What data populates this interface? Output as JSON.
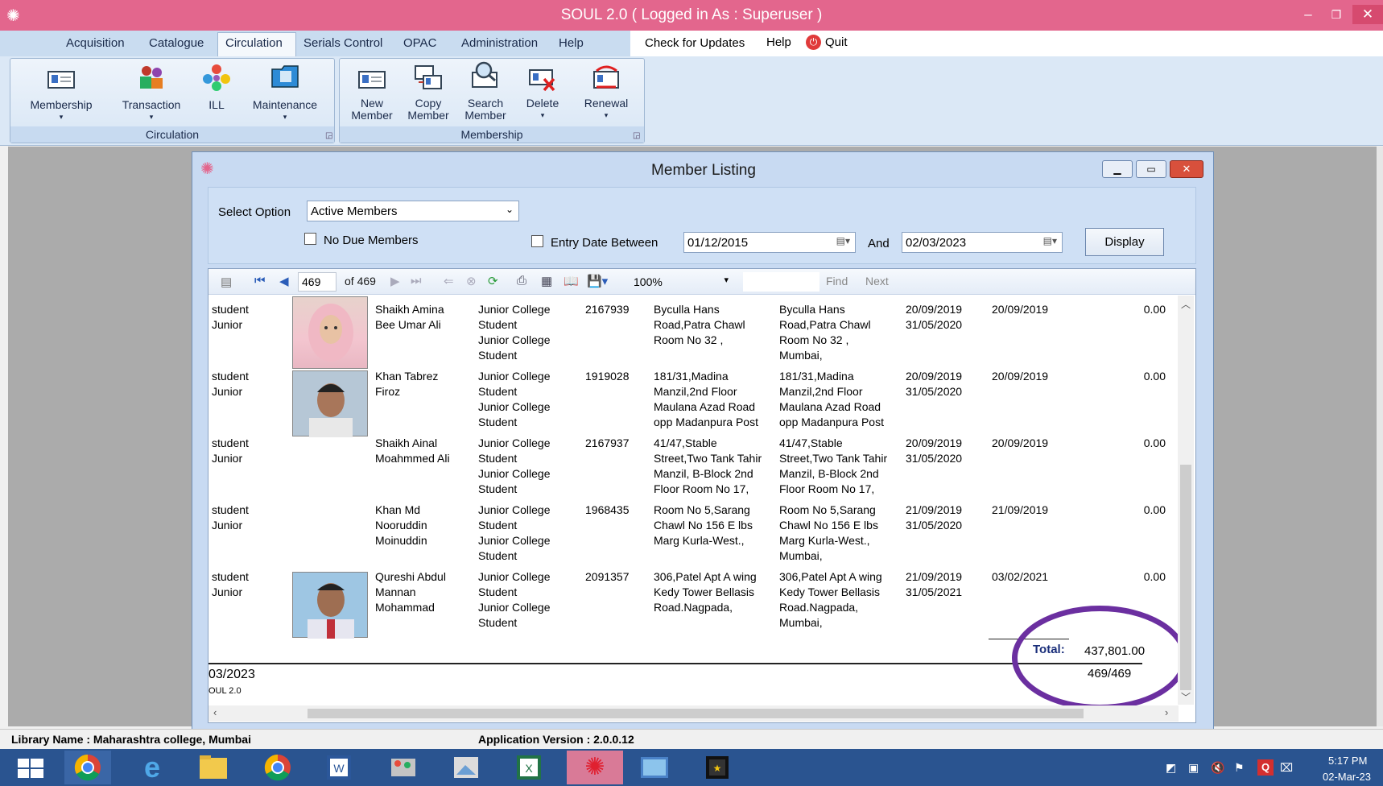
{
  "app": {
    "title": "SOUL 2.0  ( Logged in As : Superuser )"
  },
  "menu": {
    "items": [
      "Acquisition",
      "Catalogue",
      "Circulation",
      "Serials Control",
      "OPAC",
      "Administration",
      "Help"
    ],
    "right": [
      "Check for Updates",
      "Help",
      "Quit"
    ]
  },
  "ribbon": {
    "circulation_group": {
      "label": "Circulation",
      "buttons": [
        "Membership",
        "Transaction",
        "ILL",
        "Maintenance"
      ]
    },
    "membership_group": {
      "label": "Membership",
      "buttons": [
        [
          "New",
          "Member"
        ],
        [
          "Copy",
          "Member"
        ],
        [
          "Search",
          "Member"
        ],
        [
          "Delete",
          ""
        ],
        [
          "Renewal",
          ""
        ]
      ]
    }
  },
  "window": {
    "title": "Member Listing",
    "filter": {
      "select_option_label": "Select Option",
      "select_option_value": "Active Members",
      "no_due_label": "No Due Members",
      "entry_date_label": "Entry Date Between",
      "date_from": "01/12/2015",
      "and_label": "And",
      "date_to": "02/03/2023",
      "display_button": "Display"
    }
  },
  "toolbar": {
    "page": "469",
    "of_label": "of 469",
    "zoom": "100%",
    "find": "Find",
    "next": "Next"
  },
  "rows": [
    {
      "cat": [
        "student",
        "Junior"
      ],
      "name": [
        "Shaikh Amina",
        "Bee Umar Ali"
      ],
      "course": [
        "Junior College",
        "Student",
        "Junior College",
        "Student"
      ],
      "id": "2167939",
      "addr1": [
        "Byculla Hans",
        "Road,Patra Chawl",
        "Room No 32 ,"
      ],
      "addr2": [
        "Byculla Hans",
        "Road,Patra Chawl",
        "Room No 32 ,",
        "Mumbai,"
      ],
      "dates": [
        "20/09/2019",
        "31/05/2020"
      ],
      "date2": "20/09/2019",
      "amount": "0.00"
    },
    {
      "cat": [
        "student",
        "Junior"
      ],
      "name": [
        "Khan Tabrez",
        "Firoz"
      ],
      "course": [
        "Junior College",
        "Student",
        "Junior College",
        "Student"
      ],
      "id": "1919028",
      "addr1": [
        "181/31,Madina",
        "Manzil,2nd Floor",
        "Maulana Azad Road",
        "opp Madanpura Post"
      ],
      "addr2": [
        "181/31,Madina",
        "Manzil,2nd Floor",
        "Maulana Azad Road",
        "opp Madanpura Post"
      ],
      "dates": [
        "20/09/2019",
        "31/05/2020"
      ],
      "date2": "20/09/2019",
      "amount": "0.00"
    },
    {
      "cat": [
        "student",
        "Junior"
      ],
      "name": [
        "Shaikh Ainal",
        "Moahmmed Ali"
      ],
      "course": [
        "Junior College",
        "Student",
        "Junior College",
        "Student"
      ],
      "id": "2167937",
      "addr1": [
        "41/47,Stable",
        "Street,Two Tank Tahir",
        "Manzil, B-Block 2nd",
        "Floor Room No 17,"
      ],
      "addr2": [
        "41/47,Stable",
        "Street,Two Tank Tahir",
        "Manzil, B-Block 2nd",
        "Floor Room No 17,"
      ],
      "dates": [
        "20/09/2019",
        "31/05/2020"
      ],
      "date2": "20/09/2019",
      "amount": "0.00"
    },
    {
      "cat": [
        "student",
        "Junior"
      ],
      "name": [
        "Khan Md",
        "Nooruddin",
        "Moinuddin"
      ],
      "course": [
        "Junior College",
        "Student",
        "Junior College",
        "Student"
      ],
      "id": "1968435",
      "addr1": [
        "Room No 5,Sarang",
        "Chawl No 156 E lbs",
        "Marg Kurla-West.,"
      ],
      "addr2": [
        "Room No 5,Sarang",
        "Chawl No 156 E lbs",
        "Marg Kurla-West.,",
        "Mumbai,"
      ],
      "dates": [
        "21/09/2019",
        "31/05/2020"
      ],
      "date2": "21/09/2019",
      "amount": "0.00"
    },
    {
      "cat": [
        "student",
        "Junior"
      ],
      "name": [
        "Qureshi  Abdul",
        "Mannan",
        "Mohammad"
      ],
      "course": [
        "Junior College",
        "Student",
        "Junior College",
        "Student"
      ],
      "id": "2091357",
      "addr1": [
        "306,Patel Apt A wing",
        "Kedy Tower Bellasis",
        "Road.Nagpada,"
      ],
      "addr2": [
        "306,Patel Apt A wing",
        "Kedy Tower Bellasis",
        "Road.Nagpada,",
        "Mumbai,"
      ],
      "dates": [
        "21/09/2019",
        "31/05/2021"
      ],
      "date2": "03/02/2021",
      "amount": "0.00"
    }
  ],
  "totals": {
    "label": "Total:",
    "value": "437,801.00",
    "count": "469/469"
  },
  "footer": {
    "date": "03/2023",
    "app": "OUL 2.0"
  },
  "status": {
    "library": "Library Name : Maharashtra college, Mumbai",
    "version": "Application Version : 2.0.0.12"
  },
  "clock": {
    "time": "5:17 PM",
    "date": "02-Mar-23"
  },
  "colors": {
    "titlebar": "#e3668d",
    "annotation": "#6b2fa0"
  }
}
